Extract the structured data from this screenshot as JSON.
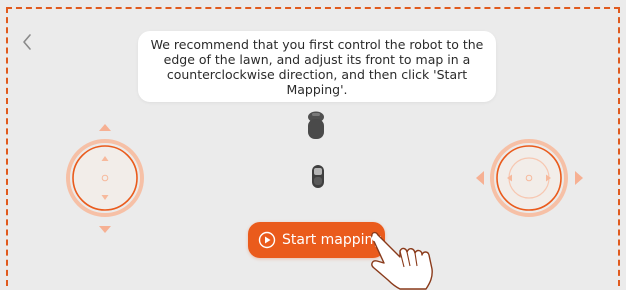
{
  "header": {
    "back_icon": "chevron-left-icon"
  },
  "tip": {
    "text": "We recommend that you first control the robot to the edge of the lawn, and adjust its front to map in a counterclockwise direction, and then click 'Start Mapping'."
  },
  "controls": {
    "left_joystick": "vertical-joystick",
    "right_joystick": "horizontal-joystick"
  },
  "start_button": {
    "label": "Start mapping",
    "icon": "play-circle-icon"
  },
  "colors": {
    "accent": "#ea5b1c",
    "background": "#ebebeb",
    "dashed_border": "#e05a1e"
  }
}
